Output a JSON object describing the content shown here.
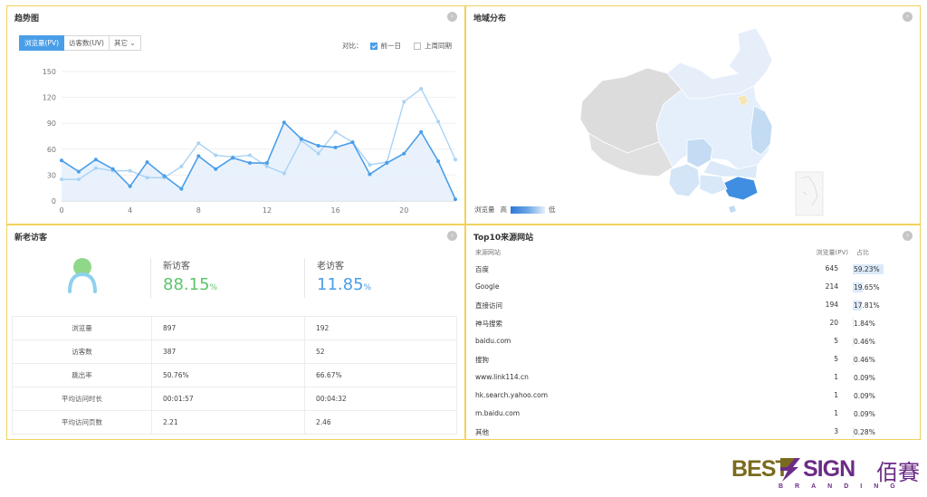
{
  "trend": {
    "title": "趋势图",
    "tabs": [
      "浏览量(PV)",
      "访客数(UV)",
      "其它"
    ],
    "compare_label": "对比：",
    "compare_options": [
      {
        "label": "前一日",
        "checked": true
      },
      {
        "label": "上周同期",
        "checked": false
      }
    ]
  },
  "map": {
    "title": "地域分布",
    "legend_label": "浏览量",
    "legend_high": "高",
    "legend_low": "低"
  },
  "visitors": {
    "title": "新老访客",
    "new_label": "新访客",
    "new_value": "88.15",
    "old_label": "老访客",
    "old_value": "11.85",
    "unit": "%",
    "rows": [
      {
        "label": "浏览量",
        "new": "897",
        "old": "192"
      },
      {
        "label": "访客数",
        "new": "387",
        "old": "52"
      },
      {
        "label": "跳出率",
        "new": "50.76%",
        "old": "66.67%"
      },
      {
        "label": "平均访问时长",
        "new": "00:01:57",
        "old": "00:04:32"
      },
      {
        "label": "平均访问页数",
        "new": "2.21",
        "old": "2.46"
      }
    ]
  },
  "top10": {
    "title": "Top10来源网站",
    "col_site": "来源网站",
    "col_pv": "浏览量(PV)",
    "col_pct": "占比",
    "rows": [
      {
        "site": "百度",
        "pv": "645",
        "pct": "59.23%",
        "ratio": 0.5923
      },
      {
        "site": "Google",
        "pv": "214",
        "pct": "19.65%",
        "ratio": 0.1965
      },
      {
        "site": "直接访问",
        "pv": "194",
        "pct": "17.81%",
        "ratio": 0.1781
      },
      {
        "site": "神马搜索",
        "pv": "20",
        "pct": "1.84%",
        "ratio": 0.0184
      },
      {
        "site": "baidu.com",
        "pv": "5",
        "pct": "0.46%",
        "ratio": 0.0046
      },
      {
        "site": "搜狗",
        "pv": "5",
        "pct": "0.46%",
        "ratio": 0.0046
      },
      {
        "site": "www.link114.cn",
        "pv": "1",
        "pct": "0.09%",
        "ratio": 0.0009
      },
      {
        "site": "hk.search.yahoo.com",
        "pv": "1",
        "pct": "0.09%",
        "ratio": 0.0009
      },
      {
        "site": "m.baidu.com",
        "pv": "1",
        "pct": "0.09%",
        "ratio": 0.0009
      },
      {
        "site": "其他",
        "pv": "3",
        "pct": "0.28%",
        "ratio": 0.0028
      }
    ]
  },
  "logo": {
    "best": "BEST",
    "sign": "SIGN",
    "cn": "佰賽",
    "branding": "BRANDING"
  },
  "colors": {
    "accent": "#4a9ee8",
    "series_today": "#4a9ee8",
    "series_compare": "#a9d3f5",
    "new_visitor": "#5cc46a",
    "old_visitor": "#4a9ee8",
    "panel_border": "#f2d25a"
  },
  "chart_data": {
    "type": "line",
    "x": [
      0,
      1,
      2,
      3,
      4,
      5,
      6,
      7,
      8,
      9,
      10,
      11,
      12,
      13,
      14,
      15,
      16,
      17,
      18,
      19,
      20,
      21,
      22,
      23
    ],
    "xticks": [
      0,
      4,
      8,
      12,
      16,
      20
    ],
    "yticks": [
      0,
      30,
      60,
      90,
      120,
      150
    ],
    "ylim": [
      0,
      150
    ],
    "series": [
      {
        "name": "",
        "values": [
          47,
          34,
          48,
          37,
          17,
          45,
          29,
          14,
          52,
          37,
          50,
          44,
          44,
          91,
          72,
          64,
          62,
          68,
          31,
          44,
          55,
          80,
          46,
          2
        ]
      },
      {
        "name": "",
        "values": [
          25,
          25,
          38,
          35,
          35,
          27,
          27,
          40,
          67,
          53,
          51,
          53,
          40,
          32,
          70,
          55,
          80,
          68,
          42,
          45,
          115,
          130,
          92,
          48
        ]
      }
    ]
  }
}
